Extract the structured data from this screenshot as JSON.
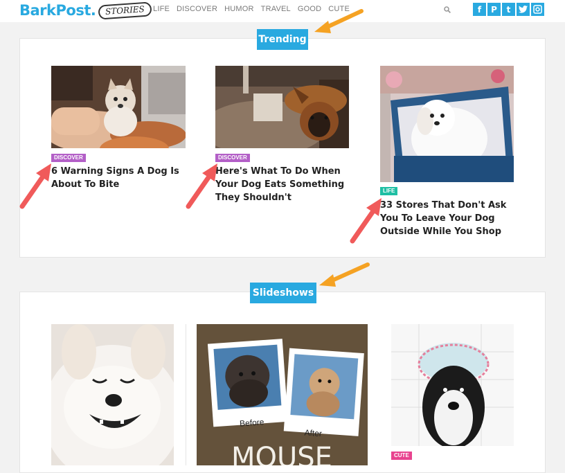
{
  "header": {
    "logo": "BarkPost.",
    "logo_badge": "STORIES",
    "nav": [
      "LIFE",
      "DISCOVER",
      "HUMOR",
      "TRAVEL",
      "GOOD",
      "CUTE"
    ],
    "social_icons": [
      "facebook-icon",
      "pinterest-icon",
      "tumblr-icon",
      "twitter-icon",
      "instagram-icon"
    ],
    "social_glyphs": [
      "f",
      "P",
      "t",
      "t",
      "◎"
    ]
  },
  "trending": {
    "label": "Trending",
    "cards": [
      {
        "tag": "DISCOVER",
        "tag_color": "#b35fc7",
        "title": "6 Warning Signs A Dog Is About To Bite"
      },
      {
        "tag": "DISCOVER",
        "tag_color": "#b35fc7",
        "title": "Here's What To Do When Your Dog Eats Something They Shouldn't"
      },
      {
        "tag": "LIFE",
        "tag_color": "#1fbfa4",
        "title": "33 Stores That Don't Ask You To Leave Your Dog Outside While You Shop"
      }
    ]
  },
  "slideshows": {
    "label": "Slideshows",
    "cards": [
      {
        "image": "smiling-white-dog"
      },
      {
        "image": "before-after-dog",
        "caption_before": "Before",
        "caption_after": "After",
        "overlay_text": "MOUSE"
      },
      {
        "image": "dog-with-shower-cap",
        "tag": "CUTE",
        "tag_color": "#e8438f"
      }
    ]
  },
  "colors": {
    "brand": "#29a9e0",
    "arrow_red": "#f05a5a",
    "arrow_orange": "#f5a223"
  }
}
